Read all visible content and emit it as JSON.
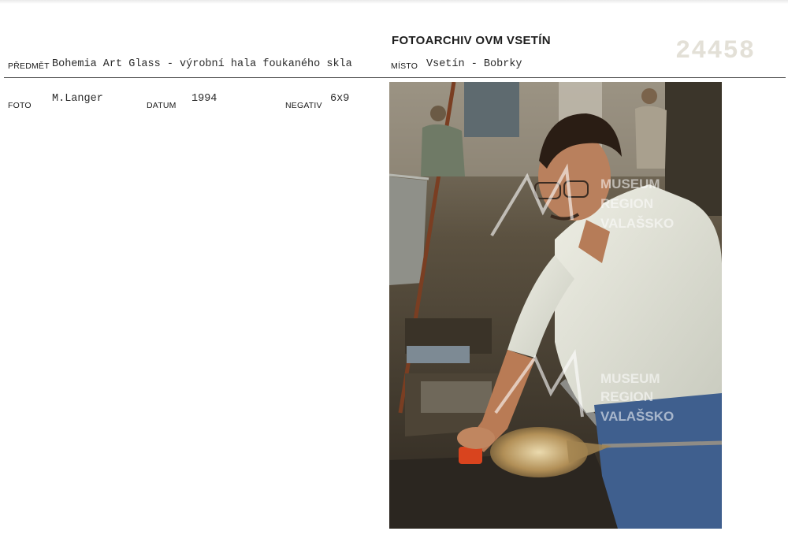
{
  "header": {
    "archive_title": "FOTOARCHIV OVM VSETÍN",
    "inventory_number": "24458"
  },
  "fields": {
    "predmet_label": "PŘEDMĚT",
    "predmet_value": "Bohemia Art Glass - výrobní hala foukaného skla",
    "misto_label": "MÍSTO",
    "misto_value": "Vsetín - Bobrky",
    "foto_label": "FOTO",
    "foto_value": "M.Langer",
    "datum_label": "DATUM",
    "datum_value": "1994",
    "negativ_label": "NEGATIV",
    "negativ_value": "6x9"
  },
  "photo": {
    "watermark_lines": [
      "MUSEUM",
      "REGION",
      "VALAŠSKO"
    ]
  }
}
